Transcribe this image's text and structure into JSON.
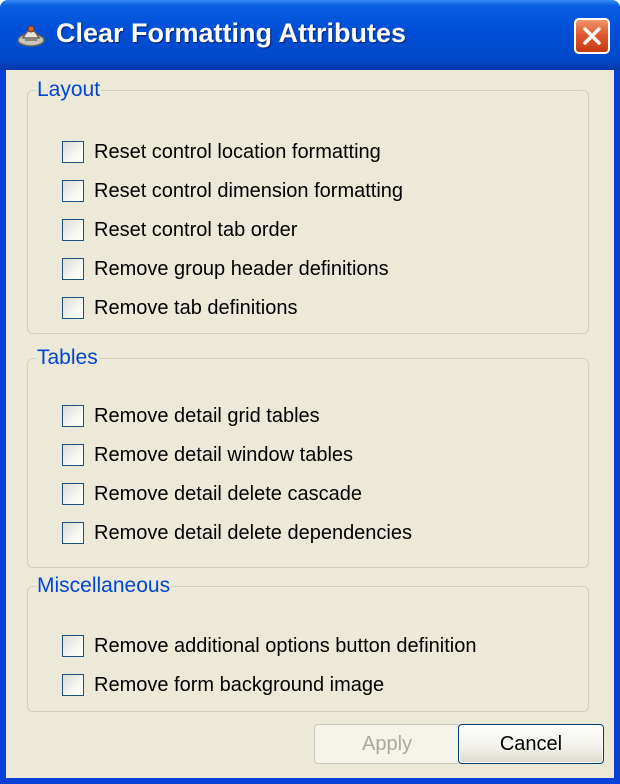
{
  "window": {
    "title": "Clear Formatting Attributes",
    "title_icon": "clear-formatting-icon",
    "close_icon": "close-icon"
  },
  "groups": [
    {
      "label": "Layout",
      "options": [
        {
          "label": "Reset control location formatting",
          "checked": false
        },
        {
          "label": "Reset control dimension formatting",
          "checked": false
        },
        {
          "label": "Reset control tab order",
          "checked": false
        },
        {
          "label": "Remove group header definitions",
          "checked": false
        },
        {
          "label": "Remove tab definitions",
          "checked": false
        }
      ]
    },
    {
      "label": "Tables",
      "options": [
        {
          "label": "Remove detail grid tables",
          "checked": false
        },
        {
          "label": "Remove detail window tables",
          "checked": false
        },
        {
          "label": "Remove detail delete cascade",
          "checked": false
        },
        {
          "label": "Remove detail delete dependencies",
          "checked": false
        }
      ]
    },
    {
      "label": "Miscellaneous",
      "options": [
        {
          "label": "Remove additional options button definition",
          "checked": false
        },
        {
          "label": "Remove form background image",
          "checked": false
        }
      ]
    }
  ],
  "buttons": {
    "apply": {
      "label": "Apply",
      "enabled": false
    },
    "cancel": {
      "label": "Cancel",
      "enabled": true
    }
  },
  "colors": {
    "titlebar": "#0050d8",
    "client_background": "#ece9d8",
    "group_label": "#0046d5",
    "close_button": "#e0592e"
  }
}
